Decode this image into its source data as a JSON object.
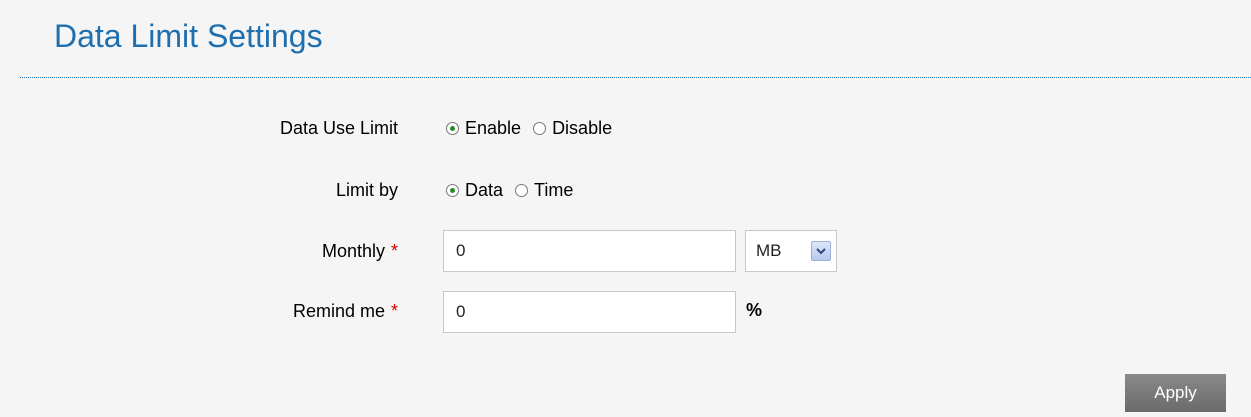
{
  "page": {
    "title": "Data Limit Settings"
  },
  "form": {
    "data_use_limit": {
      "label": "Data Use Limit",
      "options": [
        {
          "label": "Enable",
          "checked": true
        },
        {
          "label": "Disable",
          "checked": false
        }
      ]
    },
    "limit_by": {
      "label": "Limit by",
      "options": [
        {
          "label": "Data",
          "checked": true
        },
        {
          "label": "Time",
          "checked": false
        }
      ]
    },
    "monthly": {
      "label": "Monthly",
      "required_mark": "*",
      "value": "0",
      "unit_select": "MB"
    },
    "remind_me": {
      "label": "Remind me",
      "required_mark": "*",
      "value": "0",
      "unit": "%"
    }
  },
  "actions": {
    "apply_label": "Apply"
  },
  "colors": {
    "title": "#1f6fae",
    "required": "#d40000",
    "background": "#f5f5f5",
    "button": "#777777"
  }
}
